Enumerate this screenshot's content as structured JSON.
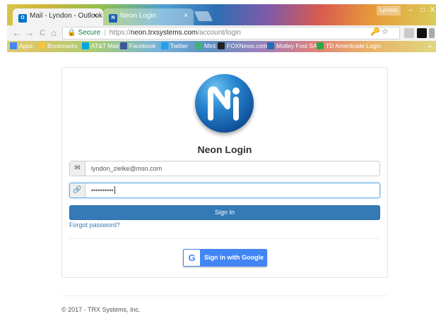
{
  "browser": {
    "tabs": [
      {
        "label": "Mail - Lyndon - Outlook",
        "favicon": "outlook-icon"
      },
      {
        "label": "Neon Login",
        "favicon": "neon-icon"
      }
    ],
    "tab_close": "×",
    "user_badge": "Lyndon",
    "window_controls": {
      "minimize": "–",
      "maximize": "□",
      "close": "X"
    },
    "nav": {
      "back": "←",
      "forward": "→",
      "reload": "C",
      "home": "⌂"
    },
    "address": {
      "secure_label": "Secure",
      "separator": "|",
      "protocol": "https://",
      "host": "neon.trxsystems.com",
      "path": "/account/login"
    },
    "omnibox_icons": {
      "key": "🔑",
      "star": "☆"
    },
    "bookmarks": [
      {
        "label": "Apps",
        "icon": "apps-icon",
        "color": "#4285f4"
      },
      {
        "label": "Bookmarks",
        "icon": "folder-icon",
        "color": "#f4c542"
      },
      {
        "label": "AT&T Mail",
        "icon": "att-icon",
        "color": "#00a8e0"
      },
      {
        "label": "Facebook",
        "icon": "facebook-icon",
        "color": "#3b5998"
      },
      {
        "label": "Twitter",
        "icon": "twitter-icon",
        "color": "#1da1f2"
      },
      {
        "label": "Mint",
        "icon": "mint-icon",
        "color": "#3cb371"
      },
      {
        "label": "FOXNews.com",
        "icon": "fox-icon",
        "color": "#222222"
      },
      {
        "label": "Motley Fool SA",
        "icon": "fool-icon",
        "color": "#1e6fb8"
      },
      {
        "label": "TD Ameritrade Login",
        "icon": "td-icon",
        "color": "#2aa846"
      }
    ],
    "bookmarks_overflow": "»"
  },
  "login": {
    "title": "Neon Login",
    "email_icon": "✉",
    "email_value": "lyndon_zielke@msn.com",
    "password_icon": "🔗",
    "password_value": "••••••••••",
    "sign_in_label": "Sign In",
    "forgot_label": "Forgot password?",
    "google_letter": "G",
    "google_label": "Sign in with Google"
  },
  "footer": {
    "copyright": "© 2017 - TRX Systems, Inc."
  },
  "colors": {
    "primary": "#337ab7",
    "google_blue": "#4285f4",
    "page_bg": "#ffffff"
  }
}
